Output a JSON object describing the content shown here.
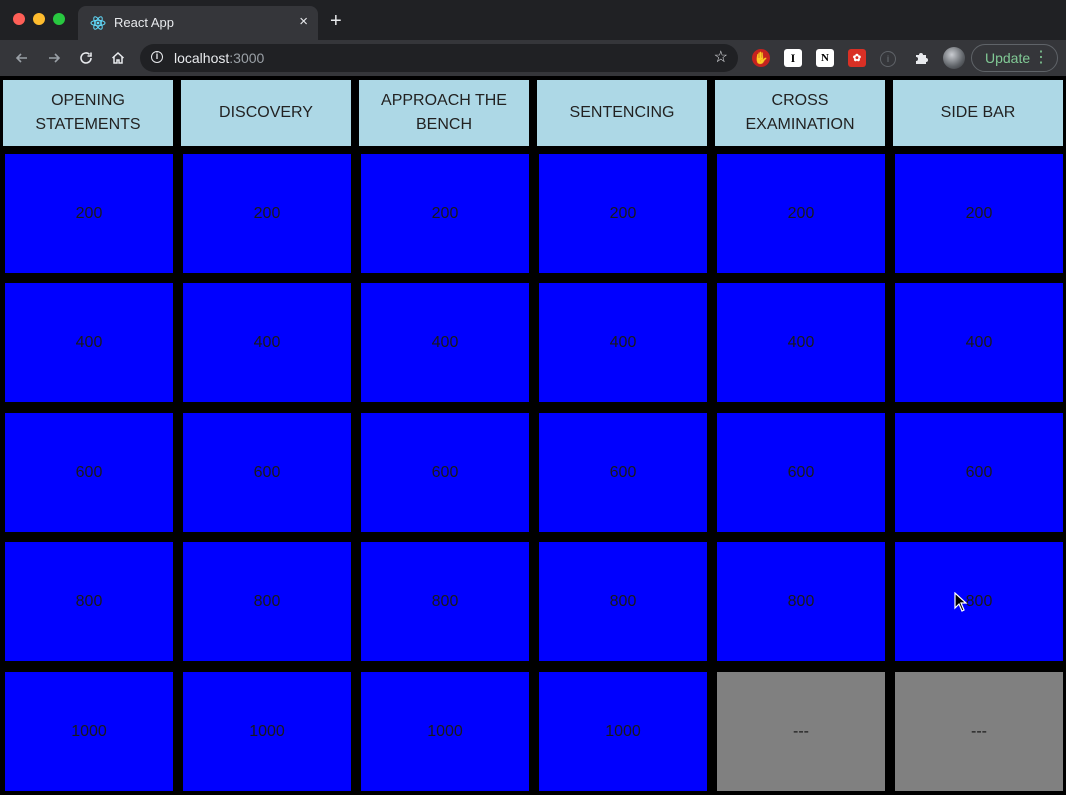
{
  "browser": {
    "tab_title": "React App",
    "tab_close": "×",
    "new_tab": "+",
    "url_host": "localhost",
    "url_port": ":3000",
    "update_label": "Update",
    "icons": [
      "back-icon",
      "forward-icon",
      "reload-icon",
      "home-icon",
      "info-icon",
      "bookmark-star-icon",
      "ublock-extension-icon",
      "instapaper-extension-icon",
      "notion-extension-icon",
      "extension-icon",
      "info-extension-icon",
      "puzzle-extensions-icon",
      "profile-avatar",
      "menu-dots-icon"
    ]
  },
  "board": {
    "colors": {
      "header_bg": "#add8e6",
      "cell_bg": "#0000ff",
      "used_bg": "#808080",
      "grid_bg": "#000000"
    },
    "categories": [
      "OPENING STATEMENTS",
      "DISCOVERY",
      "APPROACH THE BENCH",
      "SENTENCING",
      "CROSS EXAMINATION",
      "SIDE BAR"
    ],
    "rows": [
      [
        "200",
        "200",
        "200",
        "200",
        "200",
        "200"
      ],
      [
        "400",
        "400",
        "400",
        "400",
        "400",
        "400"
      ],
      [
        "600",
        "600",
        "600",
        "600",
        "600",
        "600"
      ],
      [
        "800",
        "800",
        "800",
        "800",
        "800",
        "800"
      ],
      [
        "1000",
        "1000",
        "1000",
        "1000",
        "---",
        "---"
      ]
    ],
    "used": [
      [
        false,
        false,
        false,
        false,
        false,
        false
      ],
      [
        false,
        false,
        false,
        false,
        false,
        false
      ],
      [
        false,
        false,
        false,
        false,
        false,
        false
      ],
      [
        false,
        false,
        false,
        false,
        false,
        false
      ],
      [
        false,
        false,
        false,
        false,
        true,
        true
      ]
    ]
  }
}
